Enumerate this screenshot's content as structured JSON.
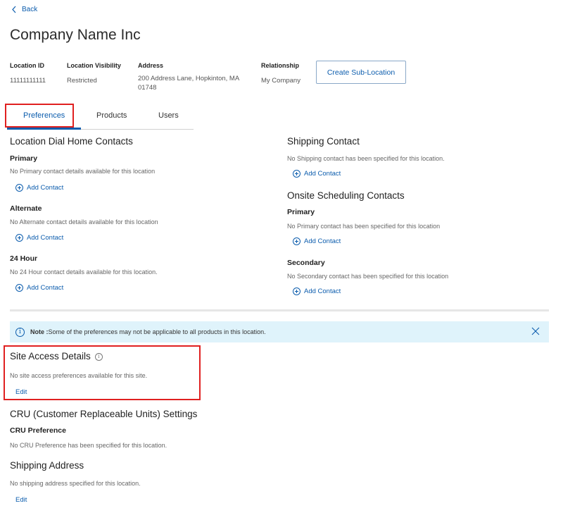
{
  "header": {
    "back_label": "Back",
    "page_title": "Company Name Inc"
  },
  "location_meta": {
    "location_id_label": "Location ID",
    "location_id_value": "11111111111",
    "visibility_label": "Location Visibility",
    "visibility_value": "Restricted",
    "address_label": "Address",
    "address_line1": "200 Address Lane, Hopkinton, MA",
    "address_line2": "01748",
    "relationship_label": "Relationship",
    "relationship_value": "My Company",
    "create_button": "Create Sub-Location"
  },
  "tabs": [
    {
      "label": "Preferences",
      "selected": true
    },
    {
      "label": "Products",
      "selected": false
    },
    {
      "label": "Users",
      "selected": false
    }
  ],
  "dial_home": {
    "title": "Location Dial Home Contacts",
    "primary_label": "Primary",
    "primary_text": "No Primary contact details available for this location",
    "alternate_label": "Alternate",
    "alternate_text": "No Alternate contact details available for this location",
    "hour24_label": "24 Hour",
    "hour24_text": "No 24 Hour contact details available for this location.",
    "add_contact": "Add Contact"
  },
  "shipping_contact": {
    "title": "Shipping Contact",
    "text": "No Shipping contact has been specified for this location.",
    "add_contact": "Add Contact"
  },
  "onsite": {
    "title": "Onsite Scheduling Contacts",
    "primary_label": "Primary",
    "primary_text": "No Primary contact has been specified for this location",
    "secondary_label": "Secondary",
    "secondary_text": "No Secondary contact has been specified for this location",
    "add_contact": "Add Contact"
  },
  "note": {
    "prefix": "Note :",
    "text": " Some of the preferences may not be applicable to all products in this location."
  },
  "site_access": {
    "title": "Site Access Details",
    "text": "No site access preferences available for this site.",
    "edit": "Edit"
  },
  "cru": {
    "title": "CRU (Customer Replaceable Units) Settings",
    "pref_label": "CRU Preference",
    "text": "No CRU Preference has been specified for this location."
  },
  "shipping_address": {
    "title": "Shipping Address",
    "text": "No shipping address specified for this location.",
    "edit": "Edit"
  },
  "colors": {
    "link": "#0b5cad",
    "highlight_box": "#e02020",
    "note_background": "#dff3fb"
  }
}
